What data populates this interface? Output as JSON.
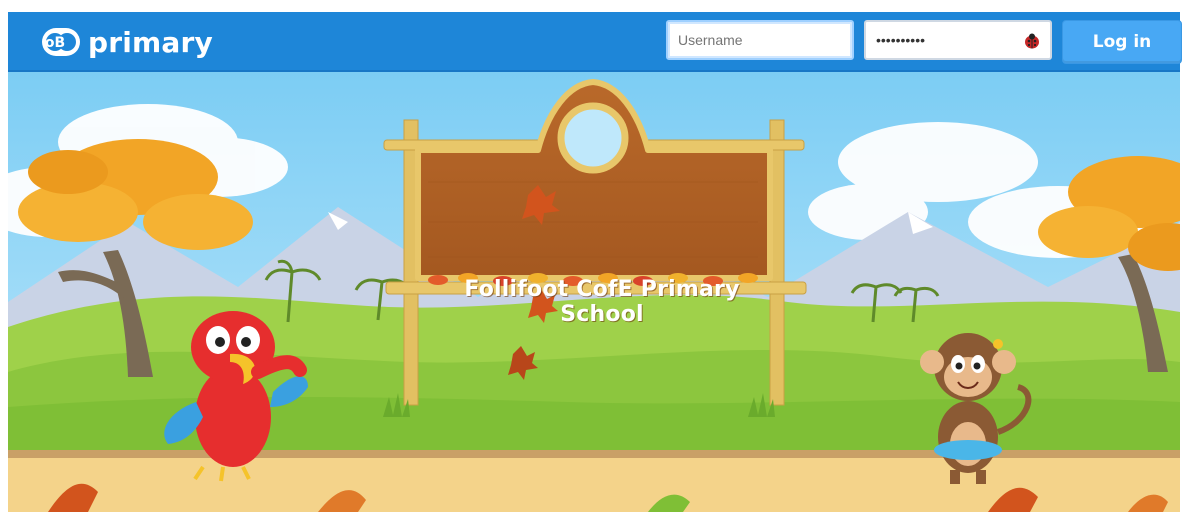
{
  "app": {
    "brand_text": "primary",
    "brand_mark_letters": "oB"
  },
  "login": {
    "username_placeholder": "Username",
    "username_value": "",
    "password_value": "••••••••••",
    "login_label": "Log in"
  },
  "banner": {
    "school_name": "Follifoot CofE Primary School"
  },
  "colors": {
    "header": "#1e86d8",
    "login_button": "#48a8f4",
    "sky": "#8fd3f5",
    "grass": "#8cc63e",
    "path": "#f4d38a"
  },
  "icons": {
    "brand": "db-logo-icon",
    "password_helper": "ladybug-icon"
  }
}
